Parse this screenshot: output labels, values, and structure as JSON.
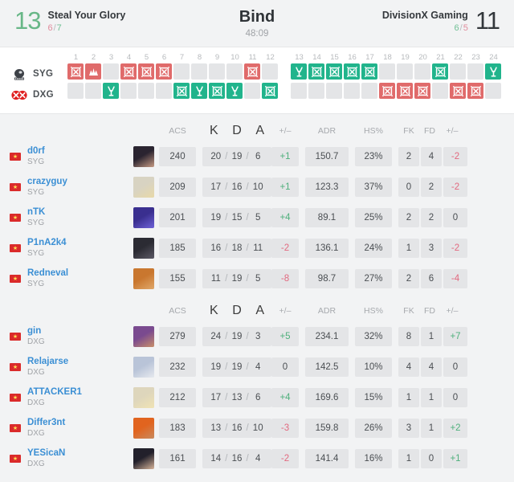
{
  "header": {
    "left_team": {
      "name": "Steal Your Glory",
      "abbr": "SYG",
      "score": "13",
      "half1": "6",
      "half2": "7",
      "result": "win"
    },
    "right_team": {
      "name": "DivisionX Gaming",
      "abbr": "DXG",
      "score": "11",
      "half1": "6",
      "half2": "5",
      "result": "lose"
    },
    "map": "Bind",
    "duration": "48:09"
  },
  "rounds": {
    "numbers_first": [
      "1",
      "2",
      "3",
      "4",
      "5",
      "6",
      "7",
      "8",
      "9",
      "10",
      "11",
      "12"
    ],
    "numbers_second": [
      "13",
      "14",
      "15",
      "16",
      "17",
      "18",
      "19",
      "20",
      "21",
      "22",
      "23",
      "24"
    ],
    "syg_label": "SYG",
    "dxg_label": "DXG",
    "syg_logo": "helmet-logo-icon",
    "dxg_logo": "double-x-logo-icon",
    "results": [
      {
        "round": "1",
        "winner": "syg",
        "color": "red",
        "icon": "elimination-icon"
      },
      {
        "round": "2",
        "winner": "syg",
        "color": "red",
        "icon": "spike-explode-icon"
      },
      {
        "round": "3",
        "winner": "dxg",
        "color": "green",
        "icon": "defuse-icon"
      },
      {
        "round": "4",
        "winner": "syg",
        "color": "red",
        "icon": "elimination-icon"
      },
      {
        "round": "5",
        "winner": "syg",
        "color": "red",
        "icon": "elimination-icon"
      },
      {
        "round": "6",
        "winner": "syg",
        "color": "red",
        "icon": "elimination-icon"
      },
      {
        "round": "7",
        "winner": "dxg",
        "color": "green",
        "icon": "elimination-icon"
      },
      {
        "round": "8",
        "winner": "dxg",
        "color": "green",
        "icon": "defuse-icon"
      },
      {
        "round": "9",
        "winner": "dxg",
        "color": "green",
        "icon": "elimination-icon"
      },
      {
        "round": "10",
        "winner": "dxg",
        "color": "green",
        "icon": "defuse-icon"
      },
      {
        "round": "11",
        "winner": "syg",
        "color": "red",
        "icon": "elimination-icon"
      },
      {
        "round": "12",
        "winner": "dxg",
        "color": "green",
        "icon": "elimination-icon"
      },
      {
        "round": "13",
        "winner": "syg",
        "color": "green",
        "icon": "defuse-icon"
      },
      {
        "round": "14",
        "winner": "syg",
        "color": "green",
        "icon": "elimination-icon"
      },
      {
        "round": "15",
        "winner": "syg",
        "color": "green",
        "icon": "elimination-icon"
      },
      {
        "round": "16",
        "winner": "syg",
        "color": "green",
        "icon": "elimination-icon"
      },
      {
        "round": "17",
        "winner": "syg",
        "color": "green",
        "icon": "elimination-icon"
      },
      {
        "round": "18",
        "winner": "dxg",
        "color": "red",
        "icon": "elimination-icon"
      },
      {
        "round": "19",
        "winner": "dxg",
        "color": "red",
        "icon": "elimination-icon"
      },
      {
        "round": "20",
        "winner": "dxg",
        "color": "red",
        "icon": "elimination-icon"
      },
      {
        "round": "21",
        "winner": "syg",
        "color": "green",
        "icon": "elimination-icon"
      },
      {
        "round": "22",
        "winner": "dxg",
        "color": "red",
        "icon": "elimination-icon"
      },
      {
        "round": "23",
        "winner": "dxg",
        "color": "red",
        "icon": "elimination-icon"
      },
      {
        "round": "24",
        "winner": "syg",
        "color": "green",
        "icon": "defuse-icon"
      }
    ]
  },
  "columns": {
    "acs": "ACS",
    "k": "K",
    "d": "D",
    "a": "A",
    "pm": "+/–",
    "adr": "ADR",
    "hs": "HS%",
    "fk": "FK",
    "fd": "FD",
    "pm2": "+/–"
  },
  "teams": [
    {
      "abbr": "SYG",
      "players": [
        {
          "name": "d0rf",
          "team": "SYG",
          "flag": "vietnam-flag-icon",
          "agent": "agent-portrait",
          "agent_colors": [
            "#2a2430",
            "#c79b84"
          ],
          "acs": "240",
          "k": "20",
          "d": "19",
          "a": "6",
          "pm": "+1",
          "pm_sign": "pos",
          "adr": "150.7",
          "hs": "23%",
          "fk": "2",
          "fd": "4",
          "pm2": "-2",
          "pm2_sign": "neg"
        },
        {
          "name": "crazyguy",
          "team": "SYG",
          "flag": "vietnam-flag-icon",
          "agent": "agent-portrait",
          "agent_colors": [
            "#d8d3c2",
            "#e8d9a8"
          ],
          "acs": "209",
          "k": "17",
          "d": "16",
          "a": "10",
          "pm": "+1",
          "pm_sign": "pos",
          "adr": "123.3",
          "hs": "37%",
          "fk": "0",
          "fd": "2",
          "pm2": "-2",
          "pm2_sign": "neg"
        },
        {
          "name": "nTK",
          "team": "SYG",
          "flag": "vietnam-flag-icon",
          "agent": "agent-portrait",
          "agent_colors": [
            "#3a2f8f",
            "#6f63d8"
          ],
          "acs": "201",
          "k": "19",
          "d": "15",
          "a": "5",
          "pm": "+4",
          "pm_sign": "pos",
          "adr": "89.1",
          "hs": "25%",
          "fk": "2",
          "fd": "2",
          "pm2": "0",
          "pm2_sign": "zero"
        },
        {
          "name": "P1nA2k4",
          "team": "SYG",
          "flag": "vietnam-flag-icon",
          "agent": "agent-portrait",
          "agent_colors": [
            "#2b2b33",
            "#5c5a66"
          ],
          "acs": "185",
          "k": "16",
          "d": "18",
          "a": "11",
          "pm": "-2",
          "pm_sign": "neg",
          "adr": "136.1",
          "hs": "24%",
          "fk": "1",
          "fd": "3",
          "pm2": "-2",
          "pm2_sign": "neg"
        },
        {
          "name": "Redneval",
          "team": "SYG",
          "flag": "vietnam-flag-icon",
          "agent": "agent-portrait",
          "agent_colors": [
            "#c9772f",
            "#e0a86a"
          ],
          "acs": "155",
          "k": "11",
          "d": "19",
          "a": "5",
          "pm": "-8",
          "pm_sign": "neg",
          "adr": "98.7",
          "hs": "27%",
          "fk": "2",
          "fd": "6",
          "pm2": "-4",
          "pm2_sign": "neg"
        }
      ]
    },
    {
      "abbr": "DXG",
      "players": [
        {
          "name": "gin",
          "team": "DXG",
          "flag": "vietnam-flag-icon",
          "agent": "agent-portrait",
          "agent_colors": [
            "#7a4a8f",
            "#c98f6a"
          ],
          "acs": "279",
          "k": "24",
          "d": "19",
          "a": "3",
          "pm": "+5",
          "pm_sign": "pos",
          "adr": "234.1",
          "hs": "32%",
          "fk": "8",
          "fd": "1",
          "pm2": "+7",
          "pm2_sign": "pos"
        },
        {
          "name": "Relajarse",
          "team": "DXG",
          "flag": "vietnam-flag-icon",
          "agent": "agent-portrait",
          "agent_colors": [
            "#b9c4d8",
            "#e6e9ee"
          ],
          "acs": "232",
          "k": "19",
          "d": "19",
          "a": "4",
          "pm": "0",
          "pm_sign": "zero",
          "adr": "142.5",
          "hs": "10%",
          "fk": "4",
          "fd": "4",
          "pm2": "0",
          "pm2_sign": "zero"
        },
        {
          "name": "ATTACKER1",
          "team": "DXG",
          "flag": "vietnam-flag-icon",
          "agent": "agent-portrait",
          "agent_colors": [
            "#ded6bc",
            "#f0e3b4"
          ],
          "acs": "212",
          "k": "17",
          "d": "13",
          "a": "6",
          "pm": "+4",
          "pm_sign": "pos",
          "adr": "169.6",
          "hs": "15%",
          "fk": "1",
          "fd": "1",
          "pm2": "0",
          "pm2_sign": "zero"
        },
        {
          "name": "Differ3nt",
          "team": "DXG",
          "flag": "vietnam-flag-icon",
          "agent": "agent-portrait",
          "agent_colors": [
            "#e1641f",
            "#c98a5e"
          ],
          "acs": "183",
          "k": "13",
          "d": "16",
          "a": "10",
          "pm": "-3",
          "pm_sign": "neg",
          "adr": "159.8",
          "hs": "26%",
          "fk": "3",
          "fd": "1",
          "pm2": "+2",
          "pm2_sign": "pos"
        },
        {
          "name": "YESicaN",
          "team": "DXG",
          "flag": "vietnam-flag-icon",
          "agent": "agent-portrait",
          "agent_colors": [
            "#22202b",
            "#d7b49a"
          ],
          "acs": "161",
          "k": "14",
          "d": "16",
          "a": "4",
          "pm": "-2",
          "pm_sign": "neg",
          "adr": "141.4",
          "hs": "16%",
          "fk": "1",
          "fd": "0",
          "pm2": "+1",
          "pm2_sign": "pos"
        }
      ]
    }
  ],
  "colors": {
    "win_green": "#68b787",
    "round_red": "#e06b6b",
    "round_green": "#21b48c",
    "cell_bg": "#e4e5e7",
    "player_link": "#3b8fd4"
  }
}
